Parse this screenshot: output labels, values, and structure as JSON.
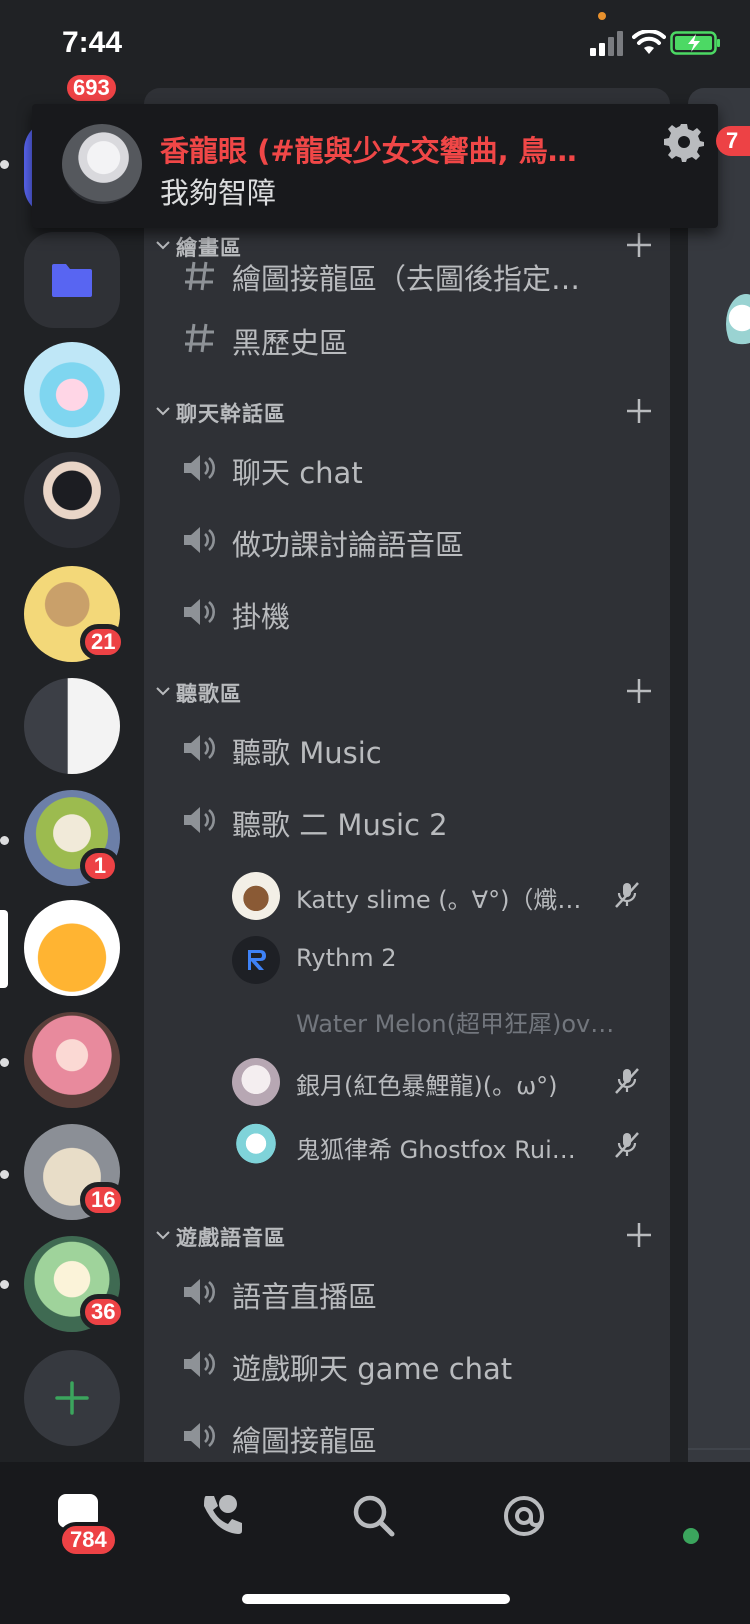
{
  "status_bar": {
    "time": "7:44"
  },
  "notification": {
    "title": "香龍眼 (#龍與少女交響曲, 鳥…",
    "message": "我夠智障",
    "right_badge": "7"
  },
  "guild_rail": {
    "top_badge": "693",
    "servers": [
      {
        "name": "server-1",
        "badge": null
      },
      {
        "name": "server-2",
        "badge": null
      },
      {
        "name": "server-3",
        "badge": "21"
      },
      {
        "name": "server-4",
        "badge": null
      },
      {
        "name": "server-5",
        "badge": "1"
      },
      {
        "name": "server-6",
        "badge": null
      },
      {
        "name": "server-7",
        "badge": null
      },
      {
        "name": "server-8",
        "badge": "16"
      },
      {
        "name": "server-9",
        "badge": "36"
      }
    ]
  },
  "channel_list": {
    "partial_top_channel": "繪圖接龍區（去圖後指定…",
    "categories": [
      {
        "label": "繪畫區",
        "channels": [
          {
            "name": "黑歷史區",
            "type": "text"
          }
        ]
      },
      {
        "label": "聊天幹話區",
        "channels": [
          {
            "name": "聊天 chat",
            "type": "voice"
          },
          {
            "name": "做功課討論語音區",
            "type": "voice"
          },
          {
            "name": "掛機",
            "type": "voice"
          }
        ]
      },
      {
        "label": "聽歌區",
        "channels": [
          {
            "name": "聽歌 Music",
            "type": "voice"
          },
          {
            "name": "聽歌 二 Music 2",
            "type": "voice"
          }
        ],
        "voice_users": [
          {
            "name": "Katty slime (。∀°)（熾…",
            "muted": true
          },
          {
            "name": "Rythm 2",
            "muted": false
          },
          {
            "name": "Water Melon(超甲狂犀)ov…",
            "muted": false
          },
          {
            "name": "銀月(紅色暴鯉龍)(。ω°)",
            "muted": true
          },
          {
            "name": "鬼狐律希 Ghostfox Rui…",
            "muted": true
          }
        ]
      },
      {
        "label": "遊戲語音區",
        "channels": [
          {
            "name": "語音直播區",
            "type": "voice"
          },
          {
            "name": "遊戲聊天 game chat",
            "type": "voice"
          },
          {
            "name": "繪圖接龍區",
            "type": "voice"
          }
        ]
      }
    ]
  },
  "tab_bar": {
    "home_badge": "784"
  }
}
